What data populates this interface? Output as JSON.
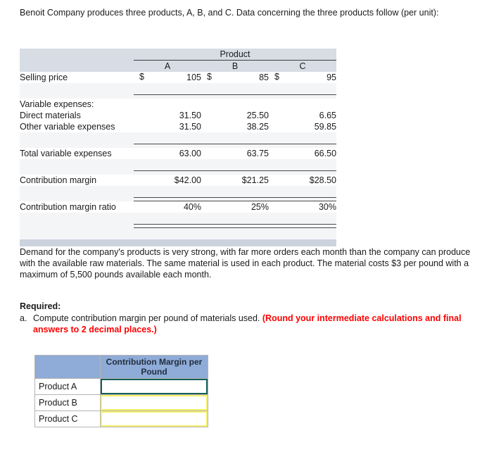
{
  "intro": {
    "text": "Benoit Company produces three products, A, B, and C. Data concerning the three products follow (per unit):"
  },
  "data_table": {
    "group_header": "Product",
    "column_headers": [
      "A",
      "B",
      "C"
    ],
    "rows": [
      {
        "label": "Selling price",
        "indent": false,
        "currency": true,
        "values": [
          "105",
          "85",
          "95"
        ]
      },
      {
        "label": "Variable expenses:",
        "indent": false,
        "currency": false,
        "values": [
          "",
          "",
          ""
        ]
      },
      {
        "label": "Direct materials",
        "indent": true,
        "currency": false,
        "values": [
          "31.50",
          "25.50",
          "6.65"
        ]
      },
      {
        "label": "Other variable expenses",
        "indent": true,
        "currency": false,
        "values": [
          "31.50",
          "38.25",
          "59.85"
        ]
      },
      {
        "label": "Total variable expenses",
        "indent": false,
        "currency": false,
        "values": [
          "63.00",
          "63.75",
          "66.50"
        ]
      },
      {
        "label": "Contribution margin",
        "indent": false,
        "currency": false,
        "values": [
          "$42.00",
          "$21.25",
          "$28.50"
        ]
      },
      {
        "label": "Contribution margin ratio",
        "indent": false,
        "currency": false,
        "values": [
          "40%",
          "25%",
          "30%"
        ]
      }
    ],
    "currency_symbol": "$"
  },
  "demand": {
    "text": "Demand for the company's products is very strong, with far more orders each month than the company can produce with the available raw materials. The same material is used in each product. The material costs $3 per pound with a maximum of 5,500 pounds available each month."
  },
  "required": {
    "title": "Required:",
    "item_marker": "a.",
    "item_text": "Compute contribution margin per pound of materials used.",
    "item_highlight": "(Round your intermediate calculations and final answers to 2 decimal places.)"
  },
  "answer_table": {
    "blank_header": "",
    "header": "Contribution Margin per Pound",
    "rows": [
      {
        "label": "Product A",
        "value": "",
        "focused": true
      },
      {
        "label": "Product B",
        "value": "",
        "focused": false
      },
      {
        "label": "Product C",
        "value": "",
        "focused": false
      }
    ]
  },
  "colors": {
    "header_band": "#d7dce5",
    "footer_band": "#ccd3de",
    "answer_header_blue": "#8fabd7",
    "input_border_yellow": "#f5f06a",
    "input_border_focus": "#16605c",
    "highlight_red": "#ff0000"
  }
}
